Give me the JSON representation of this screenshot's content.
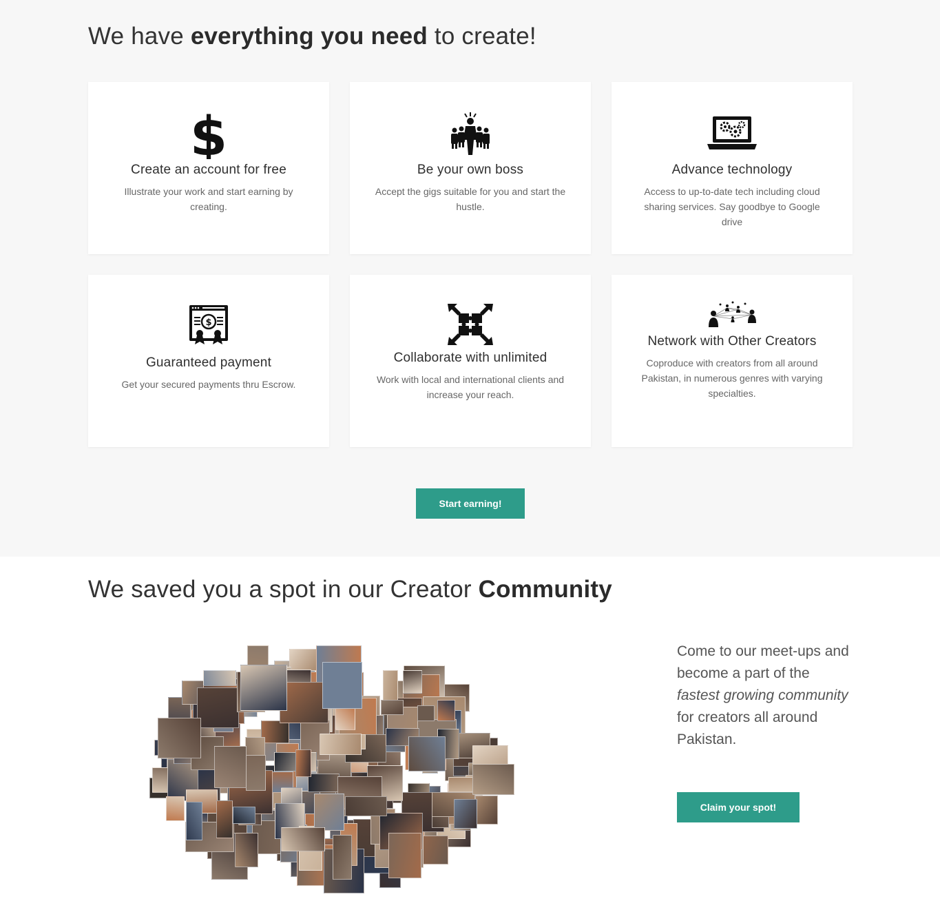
{
  "features": {
    "title_pre": "We have ",
    "title_bold": "everything you need",
    "title_post": " to create!",
    "cards": [
      {
        "icon": "dollar-icon",
        "title": "Create an account for free",
        "text": "Illustrate your work and start earning by creating."
      },
      {
        "icon": "boss-crowd-icon",
        "title": "Be your own boss",
        "text": "Accept the gigs suitable for you and start the hustle."
      },
      {
        "icon": "laptop-gears-icon",
        "title": "Advance technology",
        "text": "Access to up-to-date tech including cloud sharing services. Say goodbye to Google drive"
      },
      {
        "icon": "payment-certificate-icon",
        "title": "Guaranteed payment",
        "text": "Get your secured payments thru Escrow."
      },
      {
        "icon": "puzzle-arrows-icon",
        "title": "Collaborate with unlimited",
        "text": "Work with local and international clients and increase your reach."
      },
      {
        "icon": "network-people-icon",
        "title": "Network with Other Creators",
        "text": "Coproduce with creators from all around Pakistan, in numerous genres with varying specialties."
      }
    ],
    "cta_label": "Start earning!"
  },
  "community": {
    "title_pre": "We saved you a spot in our Creator ",
    "title_bold": "Community",
    "text_1": "Come to our meet-ups and become a part of the ",
    "text_italic": "fastest growing community",
    "text_2": " for creators all around Pakistan.",
    "cta_label": "Claim your spot!"
  },
  "colors": {
    "accent": "#2e9c8a",
    "section_bg": "#f7f7f7"
  }
}
